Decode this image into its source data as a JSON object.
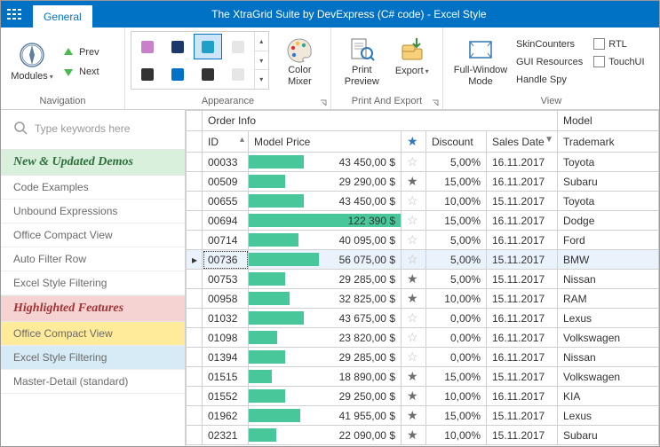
{
  "title": "The XtraGrid Suite by DevExpress (C# code) - Excel Style",
  "topTab": "General",
  "ribbon": {
    "navigation": {
      "label": "Navigation",
      "modules": "Modules",
      "prev": "Prev",
      "next": "Next"
    },
    "appearance": {
      "label": "Appearance",
      "colorMixer1": "Color",
      "colorMixer2": "Mixer"
    },
    "printExport": {
      "label": "Print And Export",
      "print1": "Print",
      "print2": "Preview",
      "export": "Export"
    },
    "view": {
      "label": "View",
      "fw1": "Full-Window",
      "fw2": "Mode",
      "skin": "SkinCounters",
      "gui": "GUI Resources",
      "spy": "Handle Spy",
      "rtl": "RTL",
      "touch": "TouchUI"
    }
  },
  "sidebar": {
    "placeholder": "Type keywords here",
    "headNew": "New & Updated Demos",
    "headHigh": "Highlighted Features",
    "itemsA": [
      "Code Examples",
      "Unbound Expressions",
      "Office Compact View",
      "Auto Filter Row",
      "Excel Style Filtering"
    ],
    "itemsB": [
      "Office Compact View",
      "Excel Style Filtering",
      "Master-Detail (standard)"
    ]
  },
  "grid": {
    "band1": "Order Info",
    "band2": "Model",
    "cols": {
      "id": "ID",
      "price": "Model Price",
      "disc": "Discount",
      "date": "Sales Date",
      "tm": "Trademark"
    },
    "maxPrice": 122390,
    "rows": [
      {
        "id": "00033",
        "price": 43450,
        "priceText": "43 450,00 $",
        "star": "out",
        "disc": "5,00%",
        "date": "16.11.2017",
        "tm": "Toyota"
      },
      {
        "id": "00509",
        "price": 29290,
        "priceText": "29 290,00 $",
        "star": "fill",
        "disc": "15,00%",
        "date": "16.11.2017",
        "tm": "Subaru"
      },
      {
        "id": "00655",
        "price": 43450,
        "priceText": "43 450,00 $",
        "star": "out",
        "disc": "10,00%",
        "date": "15.11.2017",
        "tm": "Toyota"
      },
      {
        "id": "00694",
        "price": 122390,
        "priceText": "122 390 $",
        "star": "out",
        "disc": "15,00%",
        "date": "16.11.2017",
        "tm": "Dodge"
      },
      {
        "id": "00714",
        "price": 40095,
        "priceText": "40 095,00 $",
        "star": "out",
        "disc": "5,00%",
        "date": "16.11.2017",
        "tm": "Ford"
      },
      {
        "id": "00736",
        "price": 56075,
        "priceText": "56 075,00 $",
        "star": "out",
        "disc": "5,00%",
        "date": "15.11.2017",
        "tm": "BMW",
        "sel": true
      },
      {
        "id": "00753",
        "price": 29285,
        "priceText": "29 285,00 $",
        "star": "fill",
        "disc": "5,00%",
        "date": "15.11.2017",
        "tm": "Nissan"
      },
      {
        "id": "00958",
        "price": 32825,
        "priceText": "32 825,00 $",
        "star": "fill",
        "disc": "10,00%",
        "date": "15.11.2017",
        "tm": "RAM"
      },
      {
        "id": "01032",
        "price": 43675,
        "priceText": "43 675,00 $",
        "star": "out",
        "disc": "0,00%",
        "date": "16.11.2017",
        "tm": "Lexus"
      },
      {
        "id": "01098",
        "price": 23820,
        "priceText": "23 820,00 $",
        "star": "out",
        "disc": "0,00%",
        "date": "16.11.2017",
        "tm": "Volkswagen"
      },
      {
        "id": "01394",
        "price": 29285,
        "priceText": "29 285,00 $",
        "star": "out",
        "disc": "0,00%",
        "date": "16.11.2017",
        "tm": "Nissan"
      },
      {
        "id": "01515",
        "price": 18890,
        "priceText": "18 890,00 $",
        "star": "fill",
        "disc": "15,00%",
        "date": "15.11.2017",
        "tm": "Volkswagen"
      },
      {
        "id": "01552",
        "price": 29250,
        "priceText": "29 250,00 $",
        "star": "fill",
        "disc": "10,00%",
        "date": "16.11.2017",
        "tm": "KIA"
      },
      {
        "id": "01962",
        "price": 41955,
        "priceText": "41 955,00 $",
        "star": "fill",
        "disc": "15,00%",
        "date": "15.11.2017",
        "tm": "Lexus"
      },
      {
        "id": "02321",
        "price": 22090,
        "priceText": "22 090,00 $",
        "star": "fill",
        "disc": "10,00%",
        "date": "15.11.2017",
        "tm": "Subaru"
      }
    ]
  },
  "gallery": [
    {
      "c": "#c97fc9"
    },
    {
      "c": "#1b3a6b"
    },
    {
      "c": "#1fa0c8",
      "sel": true
    },
    {
      "c": "#e6e6e6"
    },
    {
      "c": "#333"
    },
    {
      "c": "#0072c6"
    },
    {
      "c": "#333"
    },
    {
      "c": "#e6e6e6"
    }
  ]
}
